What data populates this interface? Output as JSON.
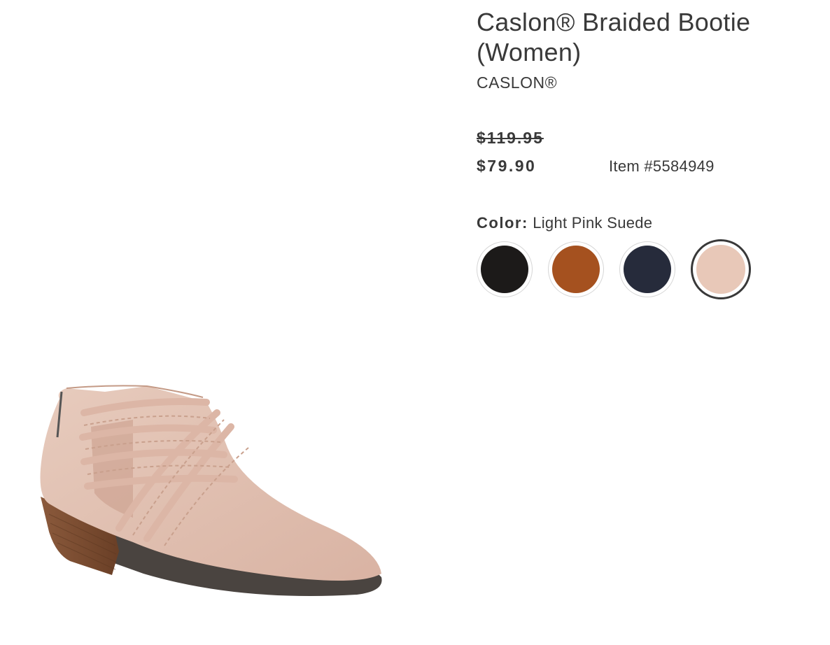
{
  "product": {
    "title_line1": "Caslon® Braided Bootie",
    "title_line2": "(Women)",
    "brand": "CASLON®",
    "original_price": "$119.95",
    "sale_price": "$79.90",
    "item_number": "Item #5584949"
  },
  "color": {
    "label": "Color:",
    "selected": "Light Pink Suede",
    "swatches": [
      {
        "name": "black",
        "hex": "#1c1a19"
      },
      {
        "name": "cognac",
        "hex": "#a5511f"
      },
      {
        "name": "navy",
        "hex": "#262b3b"
      },
      {
        "name": "light-pink-suede",
        "hex": "#e8c8b8"
      }
    ]
  }
}
